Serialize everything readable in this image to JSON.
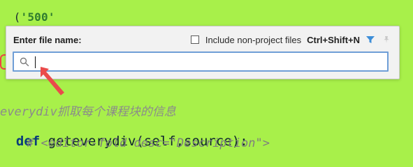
{
  "code": {
    "line_top_prefix": "(",
    "line_top_string": "'500'",
    "comment": "everydiv抓取每个课程块的信息",
    "def_keyword": "def",
    "def_rest": " geteverydiv(self,source):",
    "fold_line": "# <editor-fold desc=\"Description\">"
  },
  "dialog": {
    "title": "Enter file name:",
    "include_non_project_label": "Include non-project files",
    "shortcut": "Ctrl+Shift+N",
    "search_value": ""
  },
  "icons": {
    "filter": "filter-icon",
    "pin": "pin-icon",
    "search": "search-icon",
    "arrow": "red-arrow-icon"
  },
  "colors": {
    "background": "#a8f04a",
    "dialog_background": "#f2f2f2",
    "input_border": "#6f9ed6",
    "accent_blue": "#3d8ed8",
    "arrow_red": "#ea4b4b"
  }
}
